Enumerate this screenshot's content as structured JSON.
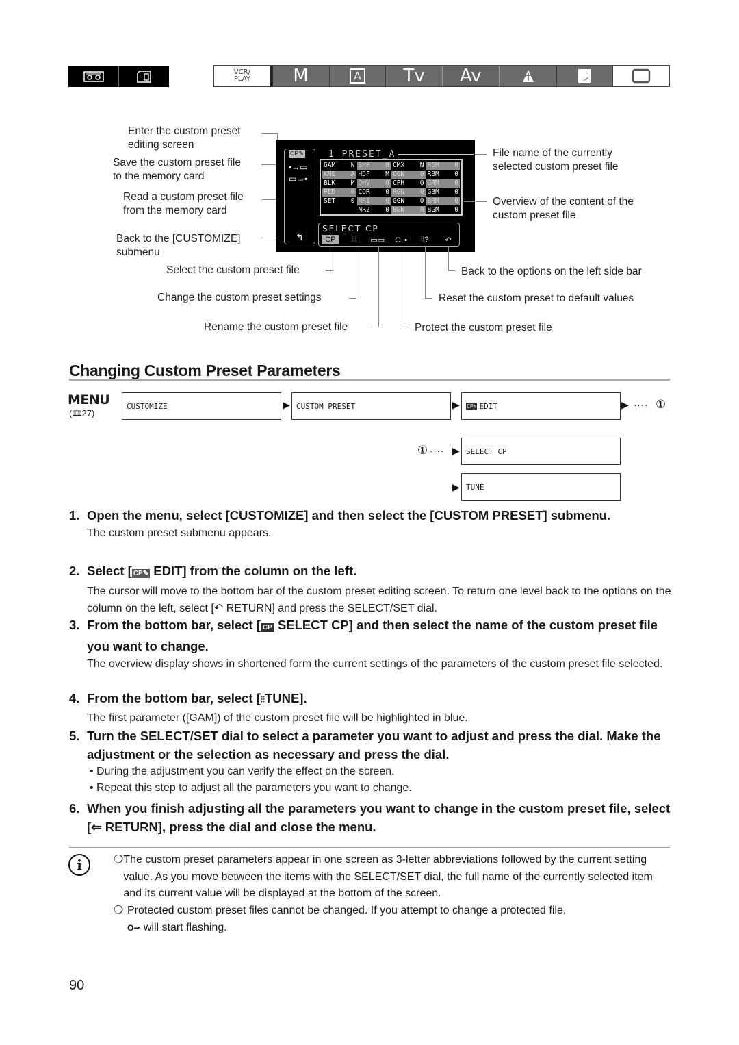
{
  "mode_tabs": {
    "left": [
      {
        "name": "tape-mode",
        "icon": "cassette-icon",
        "glyph": "⌧"
      },
      {
        "name": "card-mode",
        "icon": "memory-card-icon",
        "glyph": "▭"
      }
    ],
    "right": [
      {
        "name": "vcr-play",
        "label": "VCR/\nPLAY",
        "line1": "VCR/",
        "line2": "PLAY",
        "active": true
      },
      {
        "name": "manual",
        "label": "M"
      },
      {
        "name": "auto",
        "label": "A"
      },
      {
        "name": "shutter-priority",
        "label": "Tv"
      },
      {
        "name": "aperture-priority",
        "label": "Av"
      },
      {
        "name": "spotlight",
        "label": "♙"
      },
      {
        "name": "night",
        "label": "☽"
      },
      {
        "name": "easy",
        "label": "▢",
        "active": true
      }
    ]
  },
  "diagram": {
    "screen": {
      "file_name": "1 PRESET_A",
      "side_icons": [
        "cp-edit-icon",
        "save-to-card-icon",
        "read-from-card-icon",
        "return-icon"
      ],
      "side_glyphs": [
        "CP✎",
        "▪→▭",
        "▭→▪",
        "↰"
      ],
      "grid": [
        [
          {
            "k": "GAM",
            "v": "N"
          },
          {
            "k": "SHP",
            "v": "0",
            "dim": true
          },
          {
            "k": "CMX",
            "v": "N"
          },
          {
            "k": "RGM",
            "v": "0",
            "dim": true
          }
        ],
        [
          {
            "k": "KNE",
            "v": "A",
            "dim": true
          },
          {
            "k": "HDF",
            "v": "M"
          },
          {
            "k": "CGN",
            "v": "0",
            "dim": true
          },
          {
            "k": "RBM",
            "v": "0"
          }
        ],
        [
          {
            "k": "BLK",
            "v": "M"
          },
          {
            "k": "DHV",
            "v": "0",
            "dim": true
          },
          {
            "k": "CPH",
            "v": "0"
          },
          {
            "k": "GRM",
            "v": "0",
            "dim": true
          }
        ],
        [
          {
            "k": "PED",
            "v": "0",
            "dim": true
          },
          {
            "k": "COR",
            "v": "0"
          },
          {
            "k": "RGN",
            "v": "0",
            "dim": true
          },
          {
            "k": "GBM",
            "v": "0"
          }
        ],
        [
          {
            "k": "SET",
            "v": "0"
          },
          {
            "k": "NR1",
            "v": "0",
            "dim": true
          },
          {
            "k": "GGN",
            "v": "0"
          },
          {
            "k": "BRM",
            "v": "0",
            "dim": true
          }
        ],
        [
          {
            "k": "",
            "v": ""
          },
          {
            "k": "NR2",
            "v": "0"
          },
          {
            "k": "BGN",
            "v": "0",
            "dim": true
          },
          {
            "k": "BGM",
            "v": "0"
          }
        ]
      ],
      "bottom_bar_label": "SELECT CP",
      "bottom_icons": [
        {
          "name": "select-cp-icon",
          "glyph": "CP",
          "selected": true
        },
        {
          "name": "tune-icon",
          "glyph": "⫶⫶⫶"
        },
        {
          "name": "rename-icon",
          "glyph": "▭▭"
        },
        {
          "name": "protect-key-icon",
          "glyph": "O⊸"
        },
        {
          "name": "reset-icon",
          "glyph": "⫶⫶?"
        },
        {
          "name": "return-icon",
          "glyph": "↶"
        }
      ]
    },
    "annotations": {
      "enter_edit": "Enter the custom preset\nediting screen",
      "enter_edit_1": "Enter the custom preset",
      "enter_edit_2": "editing screen",
      "save_1": "Save the custom preset file",
      "save_2": "to the memory card",
      "read_1": "Read a custom preset file",
      "read_2": "from the memory card",
      "back_customize_1": "Back to the [CUSTOMIZE]",
      "back_customize_2": "submenu",
      "file_name_1": "File name of the currently",
      "file_name_2": "selected custom preset file",
      "overview_1": "Overview of the content of the",
      "overview_2": "custom preset file",
      "select_file": "Select the custom preset file",
      "change_settings": "Change the custom preset settings",
      "rename": "Rename the custom preset file",
      "back_left": "Back to the options on the left side bar",
      "reset": "Reset the custom preset to default values",
      "protect": "Protect the custom preset file"
    }
  },
  "section": {
    "title": "Changing Custom Preset Parameters",
    "menu_label": "MENU",
    "menu_ref": "( 27)",
    "menu_ref_icon": "book-icon",
    "path_row1": [
      "CUSTOMIZE",
      "CUSTOM PRESET",
      "EDIT"
    ],
    "path_edit_icon": "CP✎",
    "ref_marker": "①",
    "dots": "····",
    "path_row2": [
      "SELECT CP",
      "TUNE"
    ]
  },
  "steps": [
    {
      "num": "1.",
      "heading": "Open the menu, select [CUSTOMIZE] and then select the [CUSTOM PRESET] submenu.",
      "body": "The custom preset submenu appears."
    },
    {
      "num": "2.",
      "heading_pre": "Select [",
      "heading_icon": "CP✎",
      "heading_post": " EDIT] from the column on the left.",
      "body": "The cursor will move to the bottom bar of the custom preset editing screen. To return one level back to the options on the column on the left, select [↶ RETURN] and press the SELECT/SET dial."
    },
    {
      "num": "3.",
      "heading_pre": "From the bottom bar, select [",
      "heading_icon": "CP",
      "heading_post": " SELECT CP] and then select the name of the custom preset file you want to change.",
      "body": "The overview display shows in shortened form the current settings of the parameters of the custom preset file selected."
    },
    {
      "num": "4.",
      "heading_pre": "From the bottom bar, select [",
      "heading_icon": "⫶⫶",
      "heading_post": "TUNE].",
      "body": "The first parameter ([GAM]) of the custom preset file will be highlighted in blue."
    },
    {
      "num": "5.",
      "heading": "Turn the SELECT/SET dial to select a parameter you want to adjust and press the dial. Make the adjustment or the selection as necessary and press the dial.",
      "bullets": [
        "During the adjustment you can verify the effect on the screen.",
        "Repeat this step to adjust all the parameters you want to change."
      ]
    },
    {
      "num": "6.",
      "heading": "When you finish adjusting all the parameters you want to change in the custom preset file, select [⇐ RETURN], press the dial and close the menu."
    }
  ],
  "notes": {
    "icon": "info-icon",
    "items": [
      "The custom preset parameters appear in one screen as 3-letter abbreviations followed by the current setting value. As you move between the items with the SELECT/SET dial, the full name of the currently selected item and its current value will be displayed at the bottom of the screen.",
      "Protected custom preset files cannot be changed. If you attempt to change a protected file,"
    ],
    "item2_cont": "will start flashing.",
    "key_glyph": "O⊸"
  },
  "page_number": "90"
}
